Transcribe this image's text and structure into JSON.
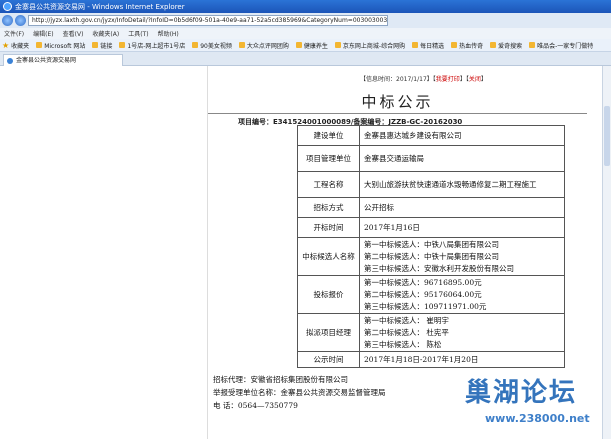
{
  "window": {
    "title": "金寨县公共资源交易网 - Windows Internet Explorer",
    "address": "http://jyzx.laxth.gov.cn/jyzx/InfoDetail/?InfoID=0b5d6f09-501a-40e9-aa71-52a5cd385969&CategoryNum=003003003",
    "menu": [
      "文件(F)",
      "编辑(E)",
      "查看(V)",
      "收藏夹(A)",
      "工具(T)",
      "帮助(H)"
    ],
    "favorites_label": "收藏夹",
    "favorites": [
      "Microsoft 网站",
      "链接",
      "1号店-网上超市1号店",
      "90美女视频",
      "大众点评网团购",
      "健康养生",
      "京东网上商城-综合网购",
      "每日精选",
      "热血传奇",
      "爱奇搜索",
      "唯品会-一家专门做特"
    ],
    "tab_label": "金寨县公共资源交易网"
  },
  "doc": {
    "meta_prefix": "【信息时间：",
    "meta_date": "2017/1/17",
    "meta_mid": "】【",
    "meta_print": "我要打印",
    "meta_sep": "】【",
    "meta_close": "关闭",
    "meta_suffix": "】",
    "title": "中标公示",
    "project_no": "项目编号：E341524001000089/备案编号：JZZB-GC-20162030",
    "rows": [
      {
        "k": "建设单位",
        "v": [
          "金寨县惠达城乡建设有限公司"
        ]
      },
      {
        "k": "项目管理单位",
        "v": [
          "金寨县交通运输局"
        ]
      },
      {
        "k": "工程名称",
        "v": [
          "大别山旅游扶贫快速通道水毁畅通修复二期工程施工"
        ]
      },
      {
        "k": "招标方式",
        "v": [
          "公开招标"
        ]
      },
      {
        "k": "开标时间",
        "v": [
          "2017年1月16日"
        ]
      },
      {
        "k": "中标候选人名称",
        "v": [
          "第一中标候选人：中铁八局集团有限公司",
          "第二中标候选人：中铁十局集团有限公司",
          "第三中标候选人：安徽水利开发股份有限公司"
        ]
      },
      {
        "k": "投标报价",
        "v": [
          "第一中标候选人：96716895.00元",
          "第二中标候选人：95176064.00元",
          "第三中标候选人：109711971.00元"
        ]
      },
      {
        "k": "拟派项目经理",
        "v": [
          "第一中标候选人：  崔明宇",
          "第二中标候选人：  杜宪平",
          "第三中标候选人：  陈松"
        ]
      },
      {
        "k": "公示时间",
        "v": [
          "2017年1月18日-2017年1月20日"
        ]
      }
    ],
    "agent": "招标代理：安徽省招标集团股份有限公司",
    "supervisor": "举报受理单位名称：金寨县公共资源交易监督管理局",
    "phone": "电 话：0564—7350779"
  },
  "watermark": {
    "text": "巢湖论坛",
    "url": "www.238000.net"
  },
  "colors": {
    "titlebar": "#1c55b8",
    "meta_link": "#cc0000",
    "watermark": "#1f66b5"
  }
}
